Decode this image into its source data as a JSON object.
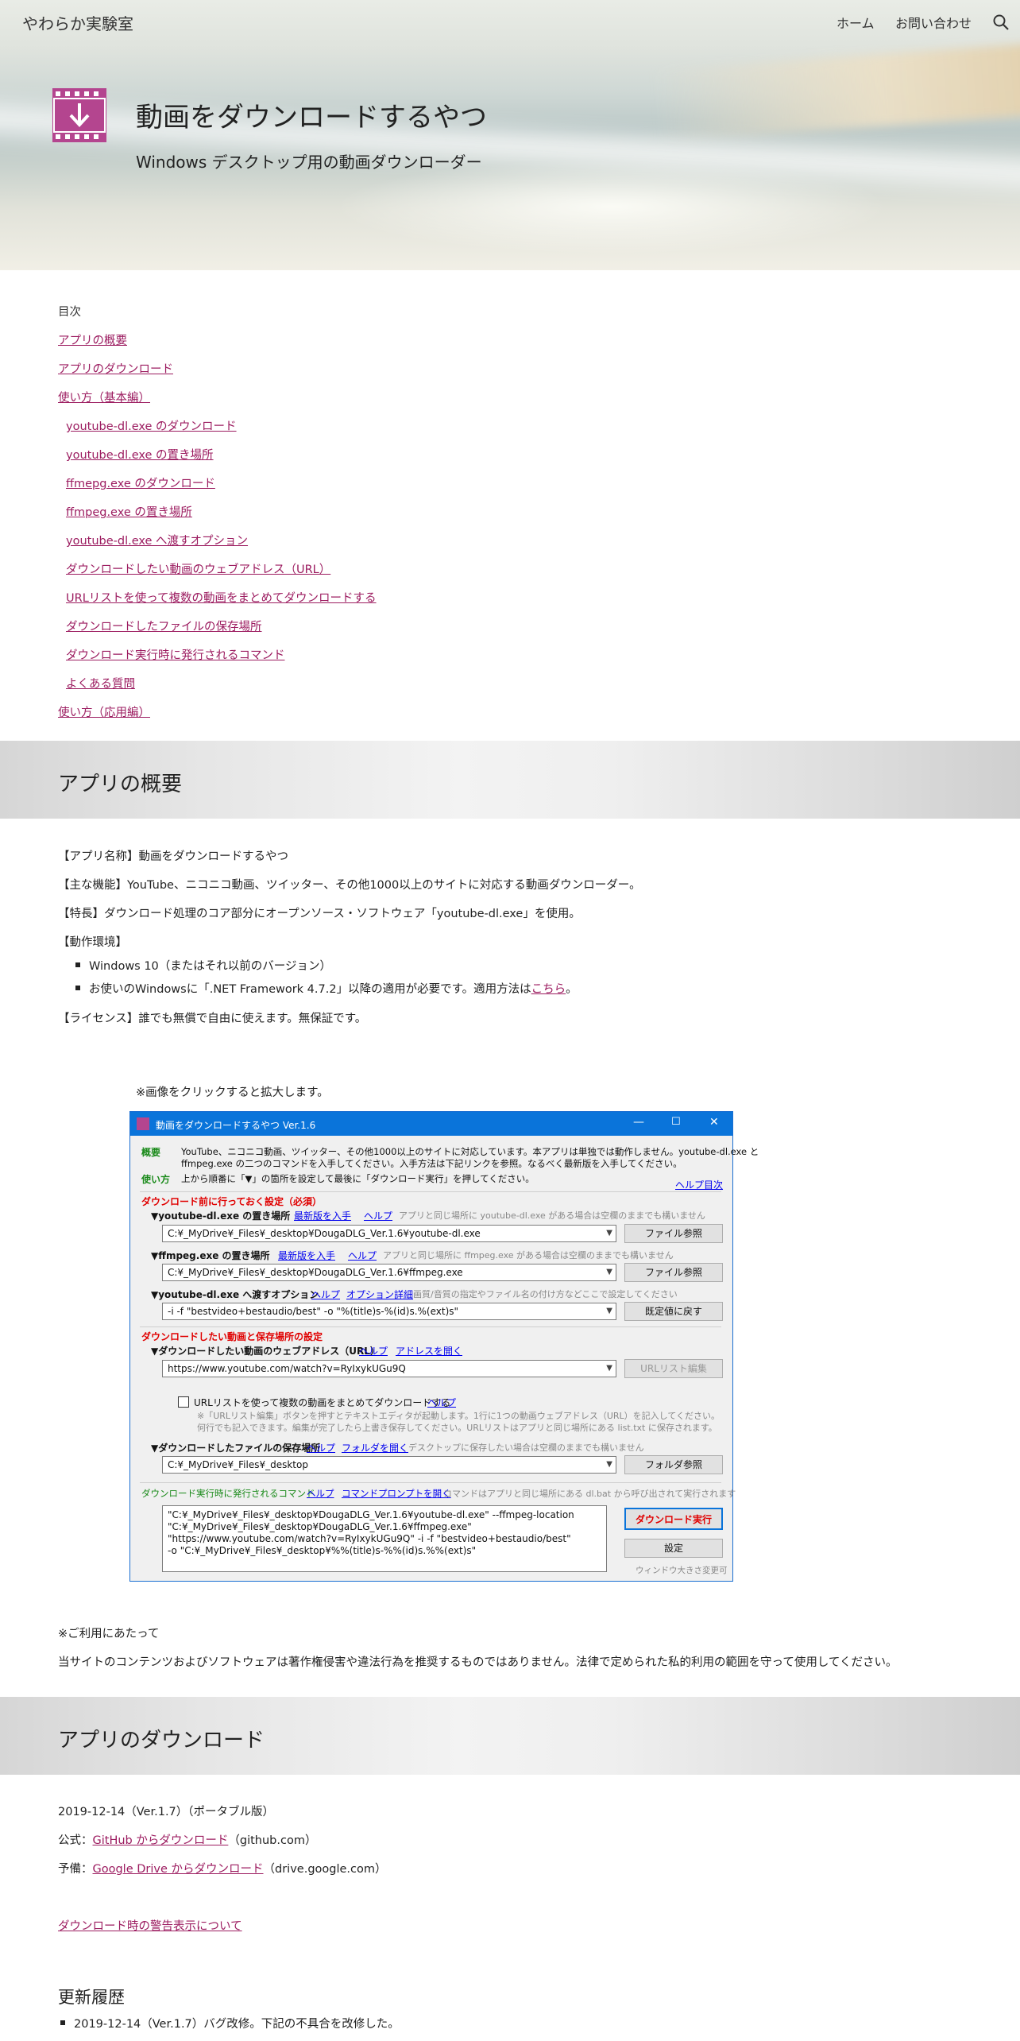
{
  "site": {
    "title": "やわらか実験室"
  },
  "nav": {
    "home": "ホーム",
    "contact": "お問い合わせ"
  },
  "hero": {
    "title": "動画をダウンロードするやつ",
    "subtitle": "Windows デスクトップ用の動画ダウンローダー"
  },
  "toc": {
    "title": "目次",
    "items": [
      "アプリの概要",
      "アプリのダウンロード",
      "使い方（基本編）",
      "youtube-dl.exe のダウンロード",
      "youtube-dl.exe の置き場所",
      "ffmepg.exe のダウンロード",
      "ffmpeg.exe の置き場所",
      "youtube-dl.exe へ渡すオプション",
      "ダウンロードしたい動画のウェブアドレス（URL）",
      "URLリストを使って複数の動画をまとめてダウンロードする",
      "ダウンロードしたファイルの保存場所",
      "ダウンロード実行時に発行されるコマンド",
      "よくある質問",
      "使い方（応用編）"
    ]
  },
  "overview": {
    "heading": "アプリの概要",
    "name": "【アプリ名称】動画をダウンロードするやつ",
    "feature": "【主な機能】YouTube、ニコニコ動画、ツイッター、その他1000以上のサイトに対応する動画ダウンローダー。",
    "special": "【特長】ダウンロード処理のコア部分にオープンソース・ソフトウェア「youtube-dl.exe」を使用。",
    "env_label": "【動作環境】",
    "env_items": [
      "Windows 10（またはそれ以前のバージョン）",
      "お使いのWindowsに「.NET Framework 4.7.2」以降の適用が必要です。適用方法は"
    ],
    "env_link": "こちら",
    "env_tail": "。",
    "license": "【ライセンス】誰でも無償で自由に使えます。無保証です。",
    "click_note": "※画像をクリックすると拡大します。"
  },
  "app_window": {
    "title": "動画をダウンロードするやつ Ver.1.6",
    "overview_label": "概要",
    "overview_text1": "YouTube、ニコニコ動画、ツイッター、その他1000以上のサイトに対応しています。本アプリは単独では動作しません。youtube-dl.exe と",
    "overview_text2": "ffmpeg.exe の二つのコマンドを入手してください。入手方法は下記リンクを参照。なるべく最新版を入手してください。",
    "howto_label": "使い方",
    "howto_text": "上から順番に「▼」の箇所を設定して最後に「ダウンロード実行」を押してください。",
    "help_toc": "ヘルプ目次",
    "sec1": "ダウンロード前に行っておく設定（必須）",
    "ytdl_label": "▼youtube-dl.exe の置き場所",
    "get_latest": "最新版を入手",
    "help": "ヘルプ",
    "ytdl_hint": "アプリと同じ場所に youtube-dl.exe がある場合は空欄のままでも構いません",
    "ytdl_path": "C:¥_MyDrive¥_Files¥_desktop¥DougaDLG_Ver.1.6¥youtube-dl.exe",
    "file_ref": "ファイル参照",
    "ffmpeg_label": "▼ffmpeg.exe の置き場所",
    "ffmpeg_hint": "アプリと同じ場所に ffmpeg.exe がある場合は空欄のままでも構いません",
    "ffmpeg_path": "C:¥_MyDrive¥_Files¥_desktop¥DougaDLG_Ver.1.6¥ffmpeg.exe",
    "opt_label": "▼youtube-dl.exe へ渡すオプション",
    "opt_detail": "オプション詳細",
    "opt_hint": "画質/音質の指定やファイル名の付け方などここで設定してください",
    "opt_value": "-i -f \"bestvideo+bestaudio/best\" -o \"%(title)s-%(id)s.%(ext)s\"",
    "reset": "既定値に戻す",
    "sec2": "ダウンロードしたい動画と保存場所の設定",
    "url_label": "▼ダウンロードしたい動画のウェブアドレス（URL）",
    "open_address": "アドレスを開く",
    "url_value": "https://www.youtube.com/watch?v=RyIxykUGu9Q",
    "url_list_edit": "URLリスト編集",
    "url_list_check": "URLリストを使って複数の動画をまとめてダウンロードする",
    "url_note1": "※「URLリスト編集」ボタンを押すとテキストエディタが起動します。1行に1つの動画ウェブアドレス（URL）を記入してください。",
    "url_note2": "何行でも記入できます。編集が完了したら上書き保存してください。URLリストはアプリと同じ場所にある list.txt に保存されます。",
    "save_label": "▼ダウンロードしたファイルの保存場所",
    "open_folder": "フォルダを開く",
    "save_hint": "デスクトップに保存したい場合は空欄のままでも構いません",
    "save_path": "C:¥_MyDrive¥_Files¥_desktop",
    "folder_ref": "フォルダ参照",
    "cmd_label": "ダウンロード実行時に発行されるコマンド",
    "open_prompt": "コマンドプロンプトを開く",
    "cmd_hint": "コマンドはアプリと同じ場所にある dl.bat から呼び出されて実行されます",
    "cmd_text": "\"C:¥_MyDrive¥_Files¥_desktop¥DougaDLG_Ver.1.6¥youtube-dl.exe\" --ffmpeg-location\n\"C:¥_MyDrive¥_Files¥_desktop¥DougaDLG_Ver.1.6¥ffmpeg.exe\"\n\"https://www.youtube.com/watch?v=RyIxykUGu9Q\" -i -f \"bestvideo+bestaudio/best\"\n-o \"C:¥_MyDrive¥_Files¥_desktop¥%%(title)s-%%(id)s.%%(ext)s\"",
    "run_download": "ダウンロード実行",
    "settings": "設定",
    "resize_note": "ウィンドウ大きさ変更可"
  },
  "notice": {
    "title": "※ご利用にあたって",
    "text": "当サイトのコンテンツおよびソフトウェアは著作権侵害や違法行為を推奨するものではありません。法律で定められた私的利用の範囲を守って使用してください。"
  },
  "download": {
    "heading": "アプリのダウンロード",
    "version": "2019-12-14（Ver.1.7）（ポータブル版）",
    "official_prefix": "公式：",
    "official_link": "GitHub からダウンロード",
    "official_suffix": "（github.com）",
    "backup_prefix": "予備：",
    "backup_link": "Google Drive からダウンロード",
    "backup_suffix": "（drive.google.com）",
    "warning_link": "ダウンロード時の警告表示について",
    "history_title": "更新履歴",
    "history_item": "2019-12-14（Ver.1.7）バグ改修。下記の不具合を改修した。"
  }
}
